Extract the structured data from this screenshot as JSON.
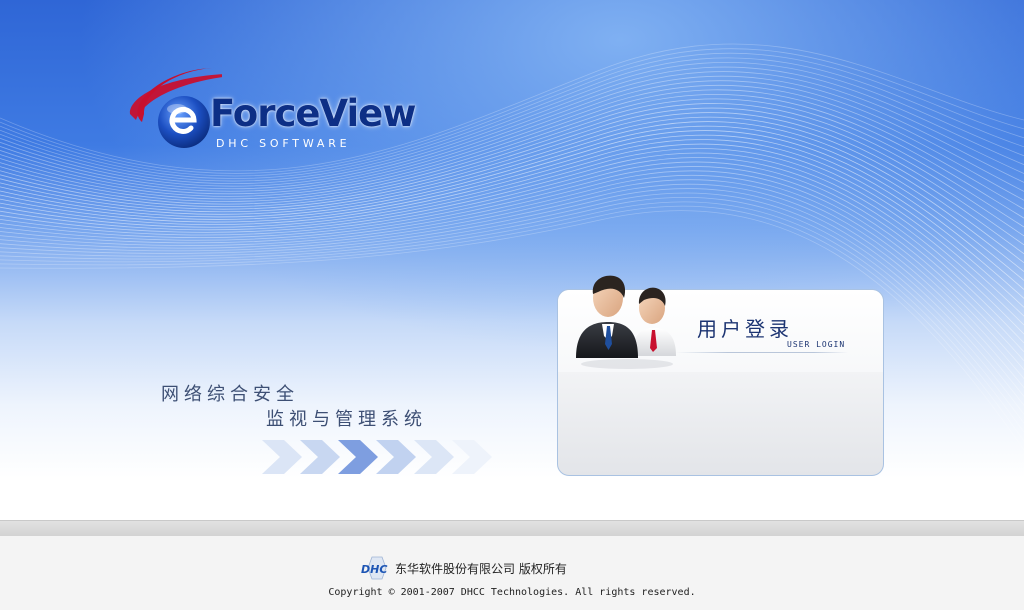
{
  "brand": {
    "name": "ForceView",
    "tagline": "DHC SOFTWARE"
  },
  "slogan": {
    "line1": "网络综合安全",
    "line2": "监视与管理系统"
  },
  "login": {
    "title": "用户登录",
    "subtitle": "USER LOGIN"
  },
  "footer": {
    "logo_text": "DHC",
    "company": "东华软件股份有限公司  版权所有",
    "copyright": "Copyright © 2001-2007 DHCC Technologies. All rights reserved."
  },
  "icons": {
    "logo": "forceview-e-globe-icon",
    "users": "two-users-icon",
    "chevrons": "chevron-arrows-icon",
    "footer_logo": "dhc-logo-icon"
  },
  "colors": {
    "brand_blue": "#0d2f86",
    "hero_top": "#2f66d6",
    "logo_swoosh": "#c8102e",
    "panel_border": "#a9c2e2",
    "chevron_accent": "#7e9ee0"
  }
}
